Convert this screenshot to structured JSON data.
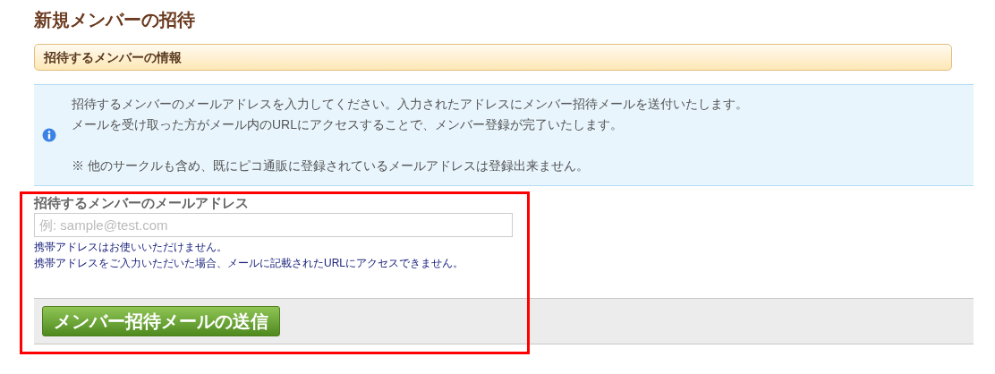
{
  "page_title": "新規メンバーの招待",
  "section_header": "招待するメンバーの情報",
  "info_box": {
    "lines": [
      "招待するメンバーのメールアドレスを入力してください。入力されたアドレスにメンバー招待メールを送付いたします。",
      "メールを受け取った方がメール内のURLにアクセスすることで、メンバー登録が完了いたします。"
    ],
    "note": "※ 他のサークルも含め、既にピコ通販に登録されているメールアドレスは登録出来ません。"
  },
  "email_field": {
    "label": "招待するメンバーのメールアドレス",
    "placeholder": "例: sample@test.com",
    "hints": [
      "携帯アドレスはお使いいただけません。",
      "携帯アドレスをご入力いただいた場合、メールに記載されたURLにアクセスできません。"
    ]
  },
  "submit_button": "メンバー招待メールの送信"
}
